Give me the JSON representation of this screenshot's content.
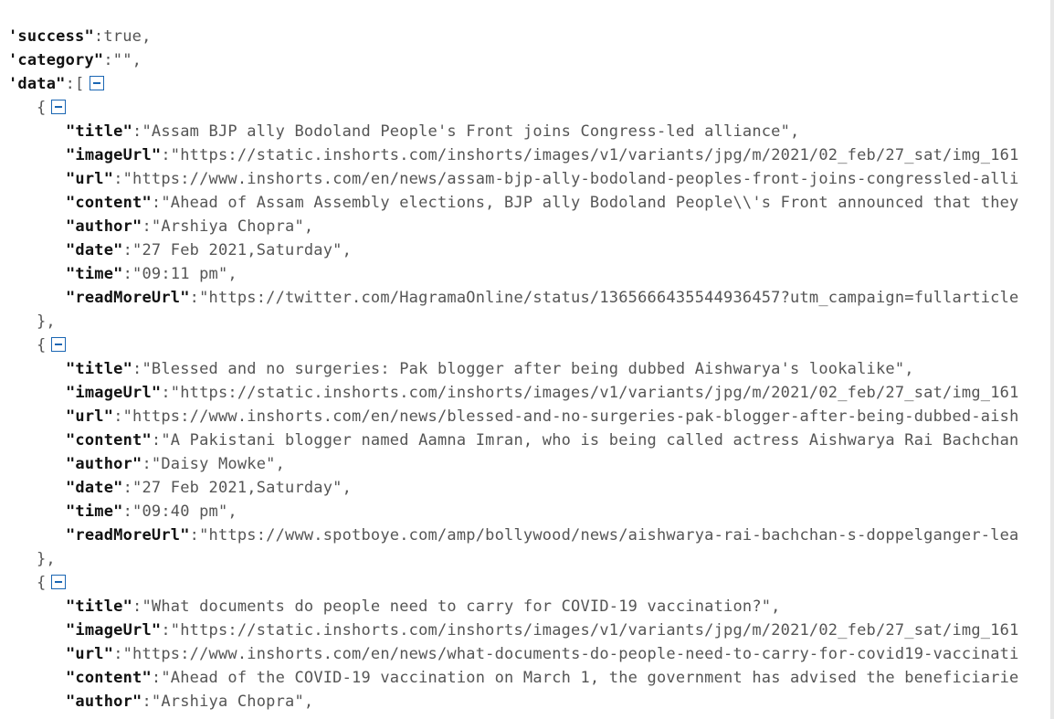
{
  "root": {
    "success_key": "'success\"",
    "success_val": ":true,",
    "category_key": "'category\"",
    "category_val": ":\"\",",
    "data_key": "'data\"",
    "data_open": ":["
  },
  "items": [
    {
      "title": "\"Assam BJP ally Bodoland People's Front joins Congress-led alliance\",",
      "imageUrl": "\"https://static.inshorts.com/inshorts/images/v1/variants/jpg/m/2021/02_feb/27_sat/img_161",
      "url": "\"https://www.inshorts.com/en/news/assam-bjp-ally-bodoland-peoples-front-joins-congressled-alli",
      "content": "\"Ahead of Assam Assembly elections, BJP ally Bodoland People\\\\'s Front announced that they",
      "author": "\"Arshiya Chopra\",",
      "date": "\"27 Feb 2021,Saturday\",",
      "time": "\"09:11 pm\",",
      "readMoreUrl": "\"https://twitter.com/HagramaOnline/status/1365666435544936457?utm_campaign=fullarticle"
    },
    {
      "title": "\"Blessed and no surgeries: Pak blogger after being dubbed Aishwarya's lookalike\",",
      "imageUrl": "\"https://static.inshorts.com/inshorts/images/v1/variants/jpg/m/2021/02_feb/27_sat/img_161",
      "url": "\"https://www.inshorts.com/en/news/blessed-and-no-surgeries-pak-blogger-after-being-dubbed-aish",
      "content": "\"A Pakistani blogger named Aamna Imran, who is being called actress Aishwarya Rai Bachchan",
      "author": "\"Daisy Mowke\",",
      "date": "\"27 Feb 2021,Saturday\",",
      "time": "\"09:40 pm\",",
      "readMoreUrl": "\"https://www.spotboye.com/amp/bollywood/news/aishwarya-rai-bachchan-s-doppelganger-lea"
    },
    {
      "title": "\"What documents do people need to carry for COVID-19 vaccination?\",",
      "imageUrl": "\"https://static.inshorts.com/inshorts/images/v1/variants/jpg/m/2021/02_feb/27_sat/img_161",
      "url": "\"https://www.inshorts.com/en/news/what-documents-do-people-need-to-carry-for-covid19-vaccinati",
      "content": "\"Ahead of the COVID-19 vaccination on March 1, the government has advised the beneficiarie",
      "author": "\"Arshiya Chopra\","
    }
  ],
  "labels": {
    "title": "\"title\"",
    "imageUrl": "\"imageUrl\"",
    "url": "\"url\"",
    "content": "\"content\"",
    "author": "\"author\"",
    "date": "\"date\"",
    "time": "\"time\"",
    "readMoreUrl": "\"readMoreUrl\"",
    "open": "{",
    "close": "},",
    "colon": ":"
  }
}
